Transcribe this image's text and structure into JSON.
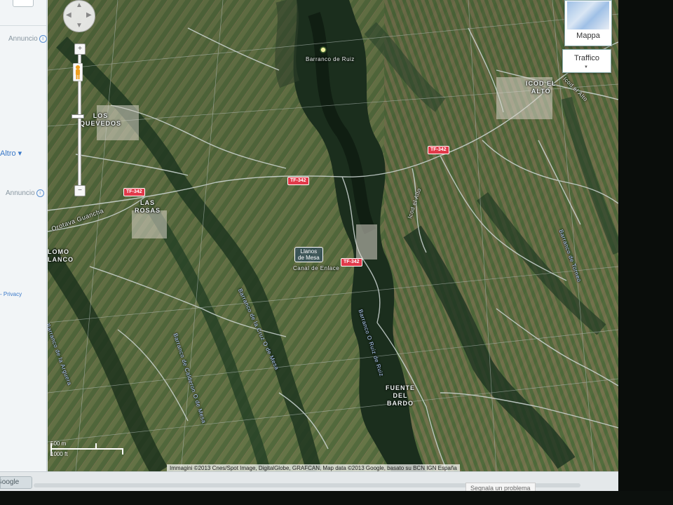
{
  "sidebar": {
    "ad1": "Annuncio",
    "link_altro": "Altro ▾",
    "ad2": "Annuncio",
    "privacy": "- Privacy",
    "info_icon": "info-icon"
  },
  "controls": {
    "pan_icon": "pan-control-icon",
    "zoom_in": "+",
    "zoom_out": "−",
    "pegman_icon": "street-view-pegman-icon",
    "maptype_label": "Mappa",
    "traffic_label": "Traffico",
    "traffic_caret": "▼"
  },
  "labels": {
    "barranco_ruiz": "Barranco de Ruiz",
    "los_quevedos_1": "LOS",
    "los_quevedos_2": "QUEVEDOS",
    "las_rosas_1": "LAS",
    "las_rosas_2": "ROSAS",
    "lomo_blanco_1": "LOMO",
    "lomo_blanco_2": "LANCO",
    "icod_alto_1": "ICOD EL",
    "icod_alto_2": "ALTO",
    "icod_alto_road": "Icod el Alto",
    "icod_alto_road2": "Icod el Alto",
    "fuente_bardo_1": "FUENTE",
    "fuente_bardo_2": "DEL",
    "fuente_bardo_3": "BARDO",
    "orotava": "Orotava Guancha",
    "llanos_1": "Llanos",
    "llanos_2": "de Mesa",
    "canal": "Canal de Enlace",
    "barranco_arguera": "Barranco de la Arguera",
    "barranco_cruz": "Barranco de la Cruz O de Mesa",
    "barranco_calderon": "Barranco de Calderon O de Mesa",
    "barranco_bardo": "Barranco O Ruiz de Ruiz",
    "barranco_lomo": "Barranco de Torneo",
    "tf_1": "TF-342",
    "tf_2": "TF-342",
    "tf_3": "TF-342",
    "tf_4": "TF-342"
  },
  "scale": {
    "metric": "500 m",
    "imperial": "1000 ft"
  },
  "attribution": "Immagini ©2013 Cnes/Spot Image, DigitalGlobe, GRAFCAN, Map data ©2013 Google, basato su BCN IGN España",
  "report_problem": "Segnala un problema",
  "bottom": {
    "google_label": "Google"
  },
  "colors": {
    "terrain_dark": "#1f3a22",
    "terrain_mid": "#4f6b3d",
    "terrain_light": "#7b8c58",
    "road": "#cfd8d6",
    "shield": "#e23a4a"
  }
}
